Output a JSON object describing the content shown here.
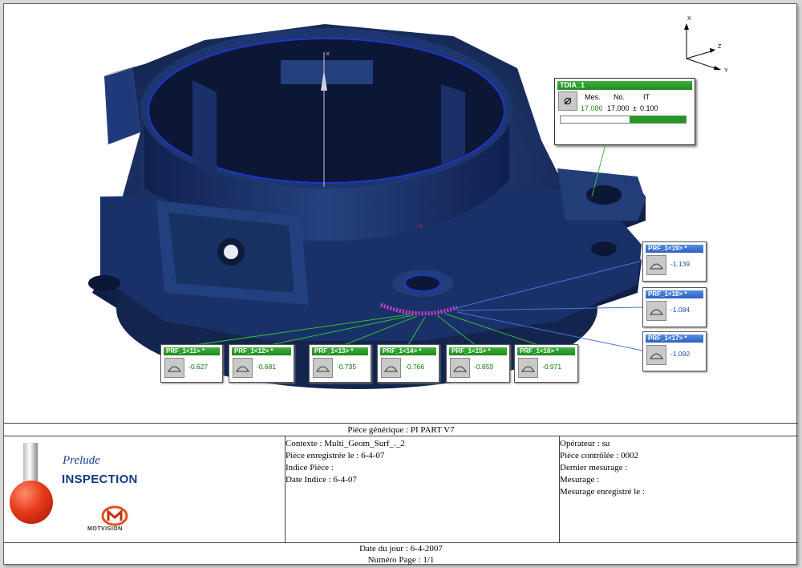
{
  "callouts": {
    "tdia": {
      "title": "TDIA_1",
      "headers": [
        "Mes.",
        "No.",
        "IT"
      ],
      "measured": "17.086",
      "nominal": "17.000",
      "pm": "±",
      "tolerance": "0.100",
      "gauge_fill_fraction": 0.45,
      "icon": "diameter-icon"
    },
    "profiles_green": [
      {
        "title": "PRF_1<11> *",
        "value": "-0.627"
      },
      {
        "title": "PRF_1<12> *",
        "value": "-0.681"
      },
      {
        "title": "PRF_1<13> *",
        "value": "-0.735"
      },
      {
        "title": "PRF_1<14> *",
        "value": "-0.766"
      },
      {
        "title": "PRF_1<15> *",
        "value": "-0.859"
      },
      {
        "title": "PRF_1<16> *",
        "value": "-0.971"
      }
    ],
    "profiles_blue": [
      {
        "title": "PRF_1<19> *",
        "value": "-1.139"
      },
      {
        "title": "PRF_1<18> *",
        "value": "-1.084"
      },
      {
        "title": "PRF_1<17> *",
        "value": "-1.092"
      }
    ],
    "icon": "profile-arc-icon",
    "green_color": "#1f8a1f",
    "blue_color": "#2a5fc0"
  },
  "axes": {
    "x": "X",
    "y": "Y",
    "z": "Z"
  },
  "footer": {
    "title": "Pièce générique : PI PART V7",
    "brand": {
      "prelude": "Prelude",
      "inspection": "INSPECTION",
      "company": "MOTVISION"
    },
    "middle": [
      "Contexte : Multi_Geom_Surf_._2",
      "Pièce enregistrée le : 6-4-07",
      "Indice Pièce :",
      "Date Indice : 6-4-07"
    ],
    "right": [
      "Opérateur : su",
      "Pièce contrôlée : 0002",
      "Dernier mesurage :",
      "Mesurage :",
      "Mesurage enregistré le :"
    ],
    "date_line": "Date du jour : 6-4-2007",
    "page_line": "Numéro Page : 1/1"
  },
  "colors": {
    "part": "#1b3266",
    "ring": "#2233cc",
    "points": "#d040d0"
  }
}
